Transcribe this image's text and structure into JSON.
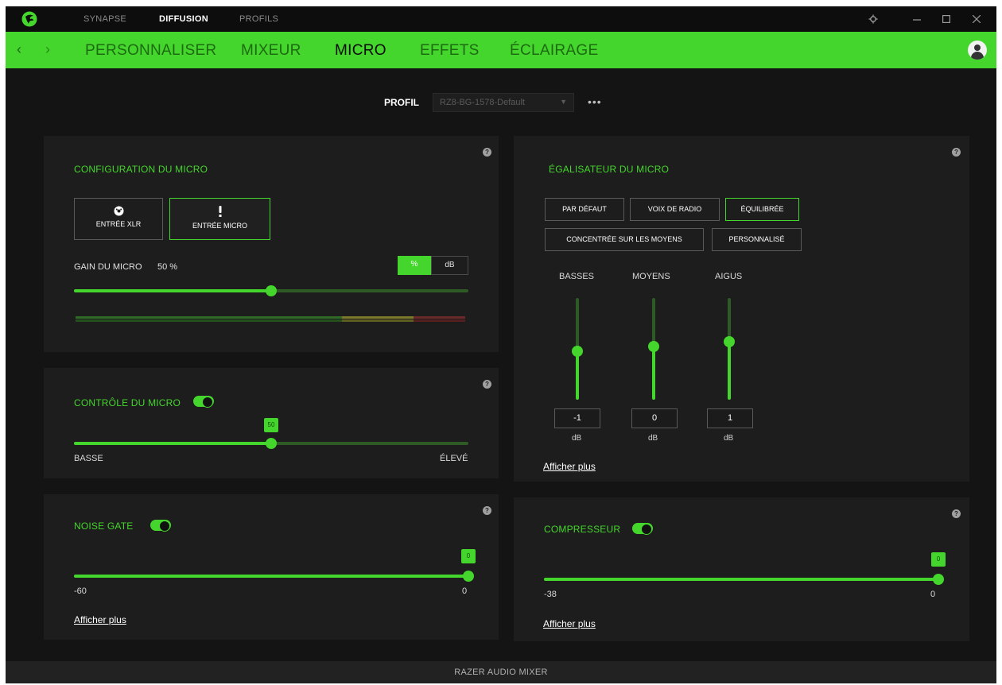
{
  "titlebar": {
    "tabs": [
      "SYNAPSE",
      "DIFFUSION",
      "PROFILS"
    ],
    "active_tab": "DIFFUSION"
  },
  "nav": {
    "tabs": [
      "PERSONNALISER",
      "MIXEUR",
      "MICRO",
      "EFFETS",
      "ÉCLAIRAGE"
    ],
    "active_tab": "MICRO"
  },
  "profile": {
    "label": "PROFIL",
    "selected": "RZ8-BG-1578-Default",
    "more": "•••"
  },
  "mic_config": {
    "title": "CONFIGURATION DU MICRO",
    "inputs": [
      {
        "label": "ENTRÉE XLR",
        "icon": "xlr-icon",
        "active": false
      },
      {
        "label": "ENTRÉE MICRO",
        "icon": "microphone-icon",
        "active": true
      }
    ],
    "gain_label": "GAIN DU MICRO",
    "gain_value": "50 %",
    "gain_percent": 50,
    "unit_percent": "%",
    "unit_db": "dB",
    "unit_selected": "%"
  },
  "mic_monitor": {
    "title": "CONTRÔLE DU MICRO",
    "enabled": true,
    "value": "50",
    "level_percent": 50,
    "min_label": "BASSE",
    "max_label": "ÉLEVÉ"
  },
  "noise_gate": {
    "title": "NOISE GATE",
    "enabled": true,
    "value": "0",
    "min_label": "-60",
    "max_label": "0",
    "level_fraction": 1.0,
    "more_link": "Afficher plus"
  },
  "equalizer": {
    "title": "ÉGALISATEUR DU MICRO",
    "presets": [
      {
        "label": "PAR DÉFAUT",
        "active": false
      },
      {
        "label": "VOIX DE RADIO",
        "active": false
      },
      {
        "label": "ÉQUILIBRÉE",
        "active": true
      },
      {
        "label": "CONCENTRÉE SUR LES MOYENS",
        "active": false
      },
      {
        "label": "PERSONNALISÉ",
        "active": false
      }
    ],
    "bands": [
      {
        "label": "BASSES",
        "value": "-1",
        "unit": "dB",
        "level_fraction": 0.48
      },
      {
        "label": "MOYENS",
        "value": "0",
        "unit": "dB",
        "level_fraction": 0.52
      },
      {
        "label": "AIGUS",
        "value": "1",
        "unit": "dB",
        "level_fraction": 0.57
      }
    ],
    "more_link": "Afficher plus"
  },
  "compressor": {
    "title": "COMPRESSEUR",
    "enabled": true,
    "value": "0",
    "min_label": "-38",
    "max_label": "0",
    "level_fraction": 1.0,
    "more_link": "Afficher plus"
  },
  "footer": {
    "label": "RAZER AUDIO MIXER"
  },
  "colors": {
    "accent": "#44d62c",
    "background": "#141414",
    "panel": "#1d1d1d"
  }
}
